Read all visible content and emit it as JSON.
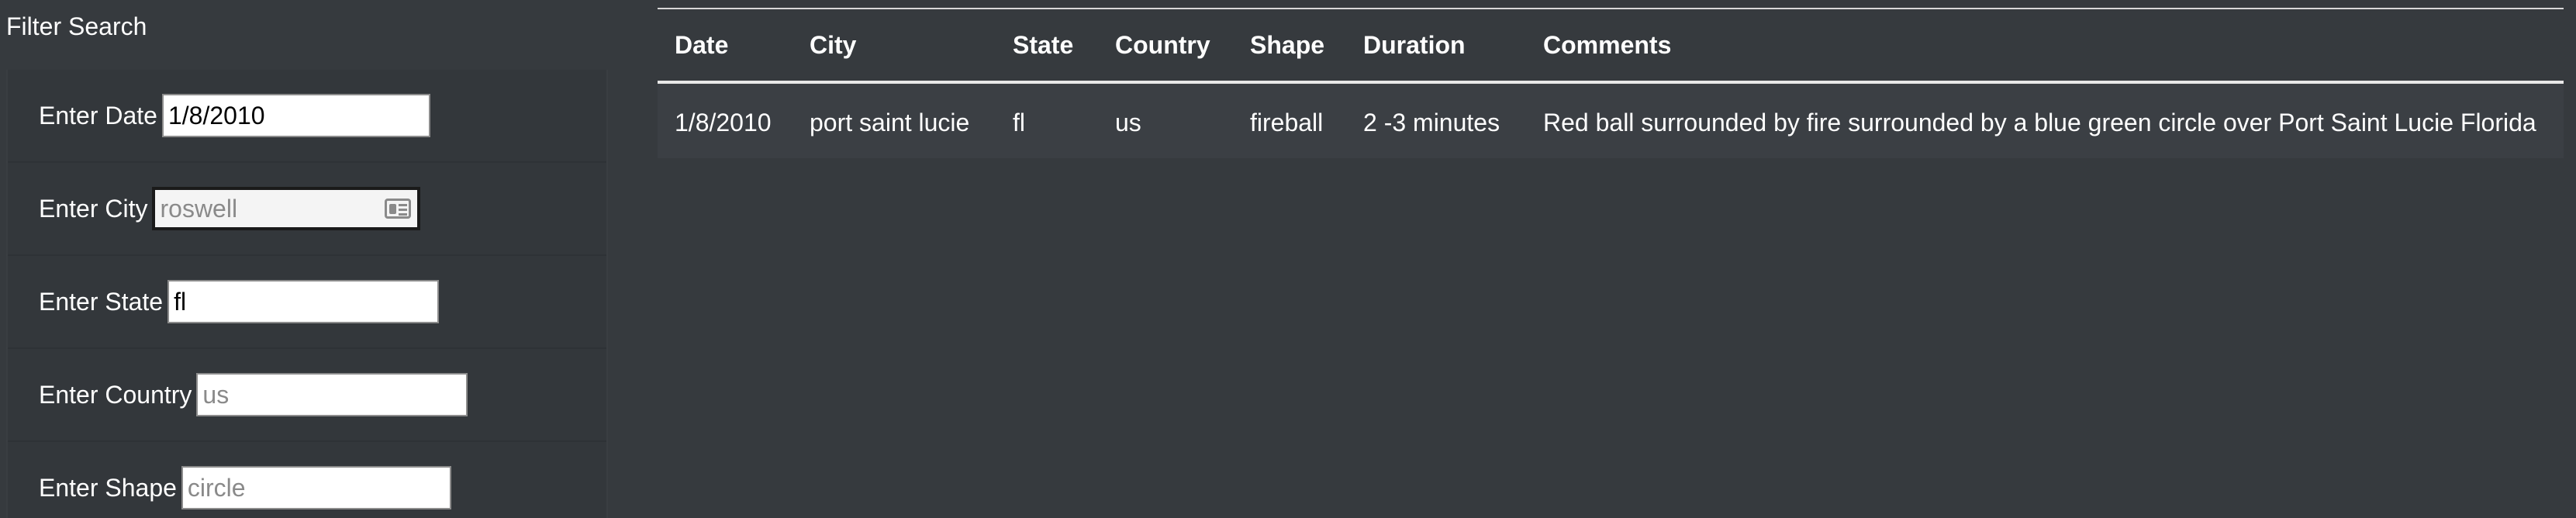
{
  "filter": {
    "title": "Filter Search",
    "fields": {
      "date": {
        "label": "Enter Date",
        "value": "1/8/2010",
        "placeholder": ""
      },
      "city": {
        "label": "Enter City",
        "value": "",
        "placeholder": "roswell"
      },
      "state": {
        "label": "Enter State",
        "value": "fl",
        "placeholder": ""
      },
      "country": {
        "label": "Enter Country",
        "value": "",
        "placeholder": "us"
      },
      "shape": {
        "label": "Enter Shape",
        "value": "",
        "placeholder": "circle"
      }
    }
  },
  "table": {
    "headers": [
      "Date",
      "City",
      "State",
      "Country",
      "Shape",
      "Duration",
      "Comments"
    ],
    "rows": [
      {
        "date": "1/8/2010",
        "city": "port saint lucie",
        "state": "fl",
        "country": "us",
        "shape": "fireball",
        "duration": "2 -3 minutes",
        "comments": "Red ball surrounded by fire surrounded by a blue green circle over Port Saint Lucie Florida"
      }
    ]
  },
  "icons": {
    "city_field_icon": "contact-card-icon"
  },
  "colors": {
    "background": "#363a3e",
    "row_background": "#3b3f44",
    "text": "#ffffff"
  }
}
